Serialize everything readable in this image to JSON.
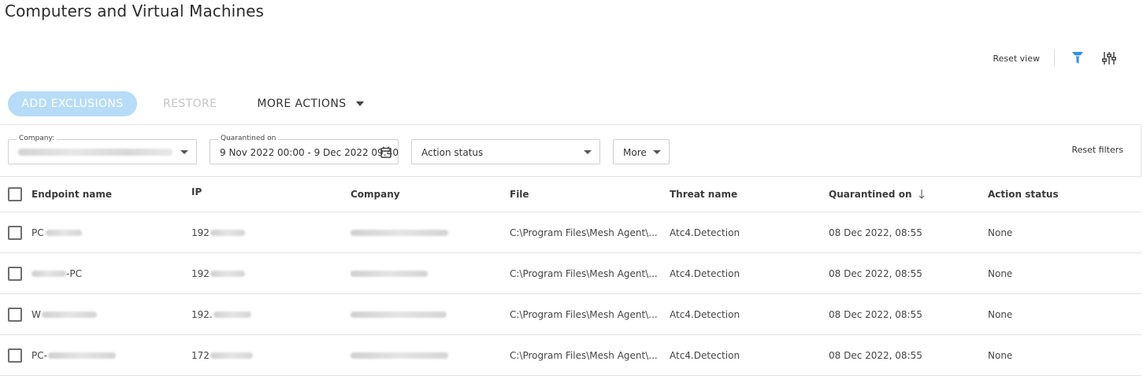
{
  "page": {
    "title": "Computers and Virtual Machines"
  },
  "toolbar": {
    "reset_view": "Reset view",
    "filter_icon": "funnel-icon",
    "columns_icon": "sliders-icon",
    "accent": "#2f8fe8"
  },
  "actions": {
    "add_exclusions": "ADD EXCLUSIONS",
    "restore": "RESTORE",
    "more_actions": "MORE ACTIONS"
  },
  "filters": {
    "company": {
      "label": "Company:",
      "value": ""
    },
    "quarantined_on": {
      "label": "Quarantined on",
      "value": "9 Nov 2022 00:00 - 9 Dec 2022 09:40"
    },
    "action_status": {
      "value": "Action status"
    },
    "more": "More",
    "reset_filters": "Reset filters"
  },
  "table": {
    "columns": [
      "Endpoint name",
      "IP",
      "Company",
      "File",
      "Threat name",
      "Quarantined on",
      "Action status"
    ],
    "sorted_column": "Quarantined on",
    "sort_direction": "descending",
    "rows": [
      {
        "endpoint_prefix": "PC",
        "endpoint_suffix": "",
        "ip": "192",
        "file": "C:\\Program Files\\Mesh Agent\\...",
        "threat": "Atc4.Detection",
        "quarantined_on": "08 Dec 2022, 08:55",
        "status": "None"
      },
      {
        "endpoint_prefix": "",
        "endpoint_suffix": "-PC",
        "ip": "192",
        "file": "C:\\Program Files\\Mesh Agent\\...",
        "threat": "Atc4.Detection",
        "quarantined_on": "08 Dec 2022, 08:55",
        "status": "None"
      },
      {
        "endpoint_prefix": "W",
        "endpoint_suffix": "",
        "ip": "192.",
        "file": "C:\\Program Files\\Mesh Agent\\...",
        "threat": "Atc4.Detection",
        "quarantined_on": "08 Dec 2022, 08:55",
        "status": "None"
      },
      {
        "endpoint_prefix": "PC-",
        "endpoint_suffix": "",
        "ip": "172",
        "file": "C:\\Program Files\\Mesh Agent\\...",
        "threat": "Atc4.Detection",
        "quarantined_on": "08 Dec 2022, 08:55",
        "status": "None"
      }
    ]
  }
}
